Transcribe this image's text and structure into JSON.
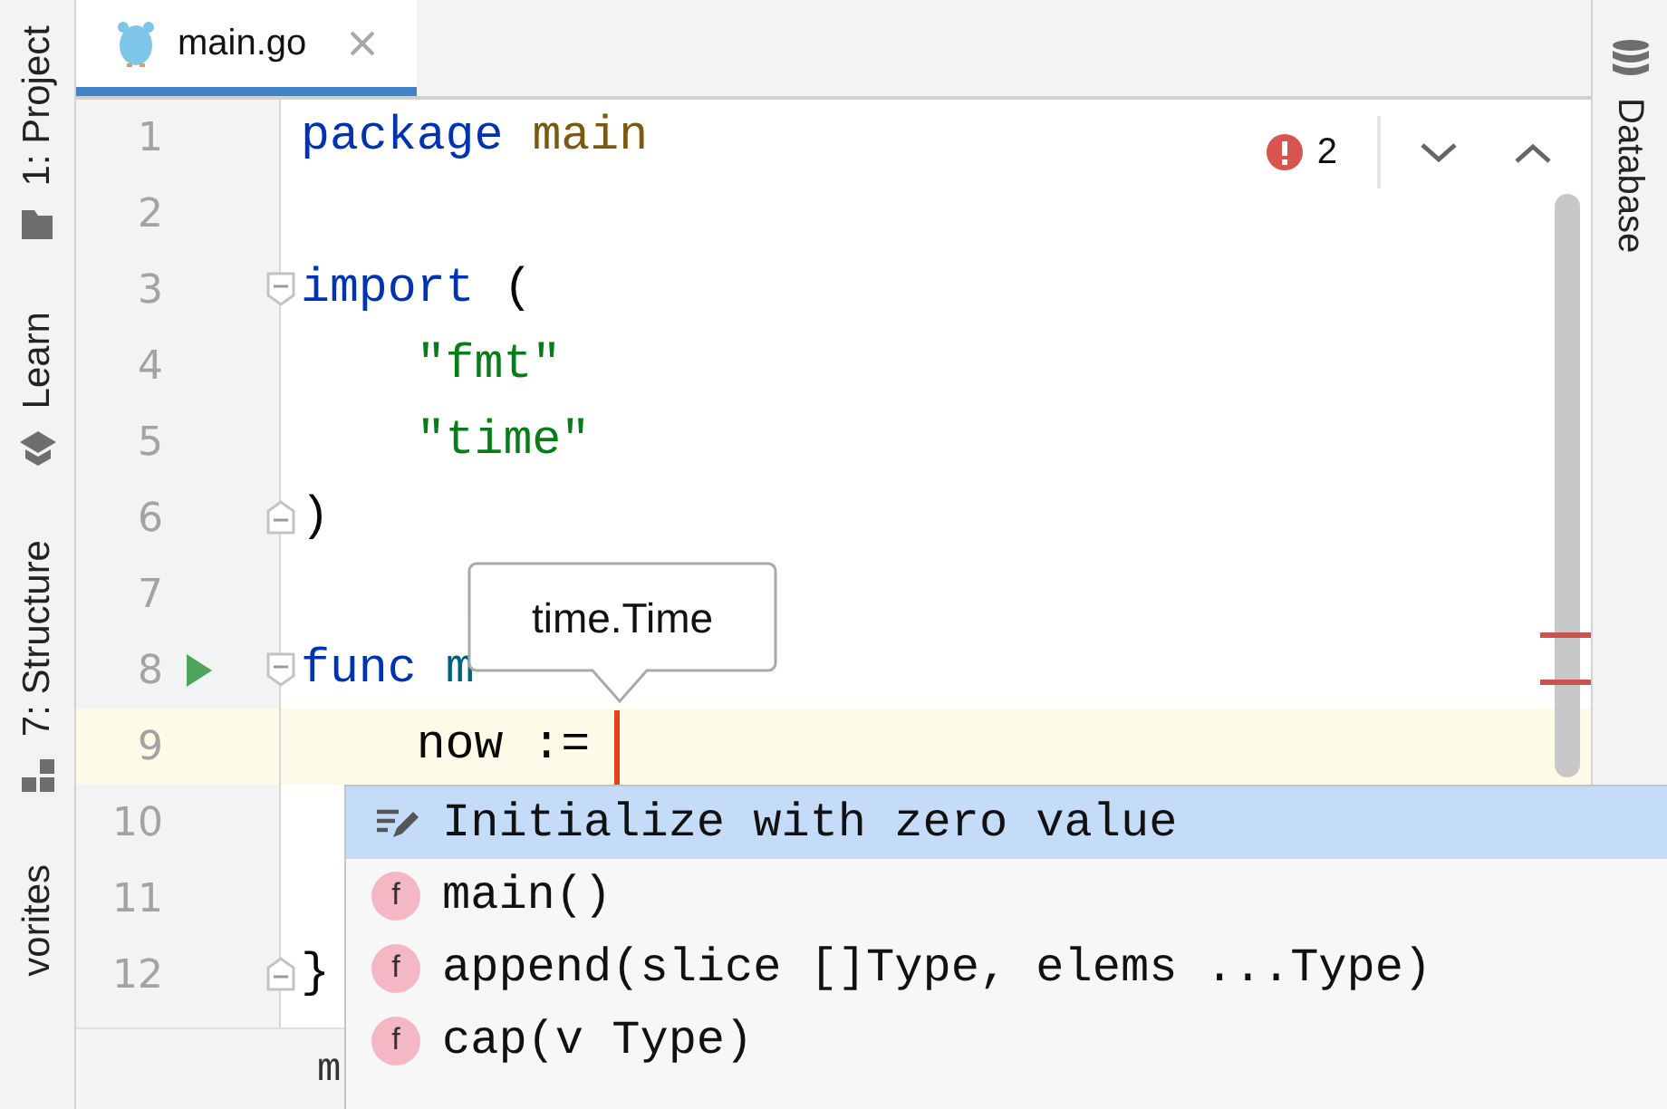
{
  "left_toolbar": [
    {
      "label": "1: Project",
      "kind": "project"
    },
    {
      "label": "Learn",
      "kind": "learn"
    },
    {
      "label": "7: Structure",
      "kind": "structure"
    },
    {
      "label": "vorites",
      "kind": "favorites"
    }
  ],
  "tabs": [
    {
      "label": "main.go",
      "selected": true
    }
  ],
  "right_toolbar": [
    {
      "label": "Database",
      "kind": "database"
    }
  ],
  "editor": {
    "problems": {
      "count": "2"
    },
    "lines": [
      {
        "number": "1",
        "current": false,
        "runnable": false,
        "fold_start": false,
        "fold_end": false,
        "tokens": [
          {
            "text": "package",
            "kind": "keyword"
          },
          {
            "text": "main",
            "kind": "package"
          }
        ]
      },
      {
        "number": "2",
        "current": false,
        "runnable": false,
        "fold_start": false,
        "fold_end": false
      },
      {
        "number": "3",
        "current": false,
        "runnable": false,
        "fold_start": true,
        "fold_end": false,
        "tokens": [
          {
            "text": "import",
            "kind": "keyword"
          },
          {
            "text": "(",
            "kind": "plain"
          }
        ]
      },
      {
        "number": "4",
        "current": false,
        "runnable": false,
        "fold_start": false,
        "fold_end": false,
        "tokens": [
          {
            "text": "    \"fmt\"",
            "kind": "string"
          }
        ]
      },
      {
        "number": "5",
        "current": false,
        "runnable": false,
        "fold_start": false,
        "fold_end": false,
        "tokens": [
          {
            "text": "    \"time\"",
            "kind": "string"
          }
        ]
      },
      {
        "number": "6",
        "current": false,
        "runnable": false,
        "fold_start": false,
        "fold_end": true,
        "tokens": [
          {
            "text": ")",
            "kind": "plain"
          }
        ]
      },
      {
        "number": "7",
        "current": false,
        "runnable": false,
        "fold_start": false,
        "fold_end": false
      },
      {
        "number": "8",
        "current": false,
        "runnable": true,
        "fold_start": true,
        "fold_end": false,
        "tokens": [
          {
            "text": "func",
            "kind": "keyword"
          },
          {
            "text": "m",
            "kind": "function"
          }
        ]
      },
      {
        "number": "9",
        "current": true,
        "runnable": false,
        "fold_start": false,
        "fold_end": false,
        "tokens": [
          {
            "text": "    now :=",
            "kind": "plain"
          }
        ]
      },
      {
        "number": "10",
        "current": false,
        "runnable": false,
        "fold_start": false,
        "fold_end": false
      },
      {
        "number": "11",
        "current": false,
        "runnable": false,
        "fold_start": false,
        "fold_end": false
      },
      {
        "number": "12",
        "current": false,
        "runnable": false,
        "fold_start": false,
        "fold_end": true,
        "tokens": [
          {
            "text": "}",
            "kind": "plain"
          }
        ]
      }
    ]
  },
  "tooltip": {
    "text": "time.Time"
  },
  "breadcrumb": {
    "text": "m"
  },
  "completion": {
    "items": [
      {
        "text": "Initialize with zero value",
        "kind": "intention",
        "selected": true
      },
      {
        "text": "main()",
        "kind": "function",
        "badge": "f",
        "selected": false
      },
      {
        "text": "append(slice []Type, elems ...Type)",
        "kind": "function",
        "badge": "f",
        "selected": false
      },
      {
        "text": "cap(v Type)",
        "kind": "function",
        "badge": "f",
        "selected": false
      }
    ]
  }
}
